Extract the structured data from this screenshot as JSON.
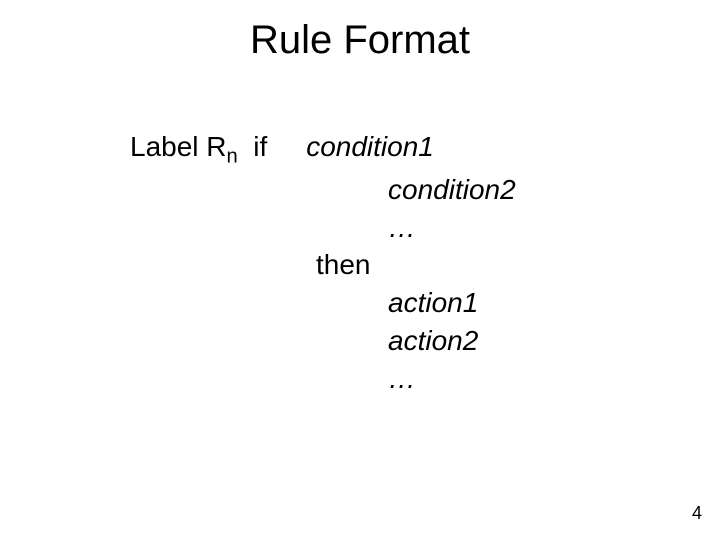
{
  "title": "Rule Format",
  "label": {
    "prefix": "Label R",
    "subscript": "n"
  },
  "keywords": {
    "if": "if",
    "then": "then"
  },
  "conditions": {
    "c1": "condition1",
    "c2": "condition2",
    "ellipsis": "…"
  },
  "actions": {
    "a1": "action1",
    "a2": "action2",
    "ellipsis": "…"
  },
  "page_number": "4"
}
